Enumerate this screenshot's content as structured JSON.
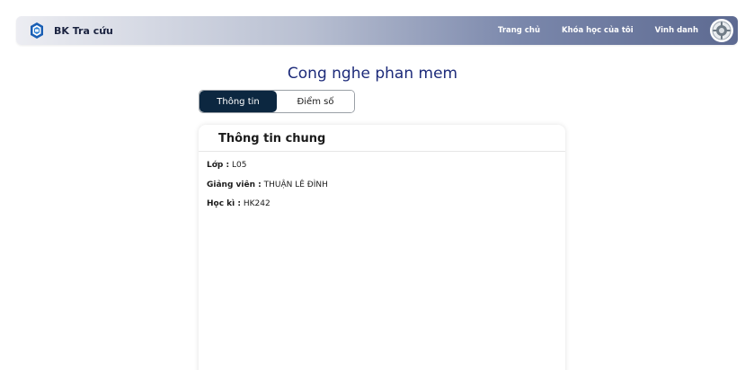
{
  "header": {
    "brand": "BK Tra cứu",
    "nav": [
      "Trang chủ",
      "Khóa học của tôi",
      "Vinh danh"
    ]
  },
  "course": {
    "title": "Cong nghe phan mem"
  },
  "tabs": [
    {
      "label": "Thông tin",
      "active": true
    },
    {
      "label": "Điểm số",
      "active": false
    }
  ],
  "info_card": {
    "title": "Thông tin chung",
    "rows": [
      {
        "label": "Lớp :",
        "value": " L05"
      },
      {
        "label": "Giảng viên :",
        "value": " THUẬN LÊ ĐÌNH"
      },
      {
        "label": "Học kì :",
        "value": " HK242"
      }
    ]
  },
  "colors": {
    "title_color": "#1d2b7a",
    "tab_active_bg": "#0c2740",
    "nav_gradient_end": "#5d6a91"
  },
  "icons": {
    "brand_logo": "bk-logo-icon",
    "avatar": "avatar-icon"
  }
}
